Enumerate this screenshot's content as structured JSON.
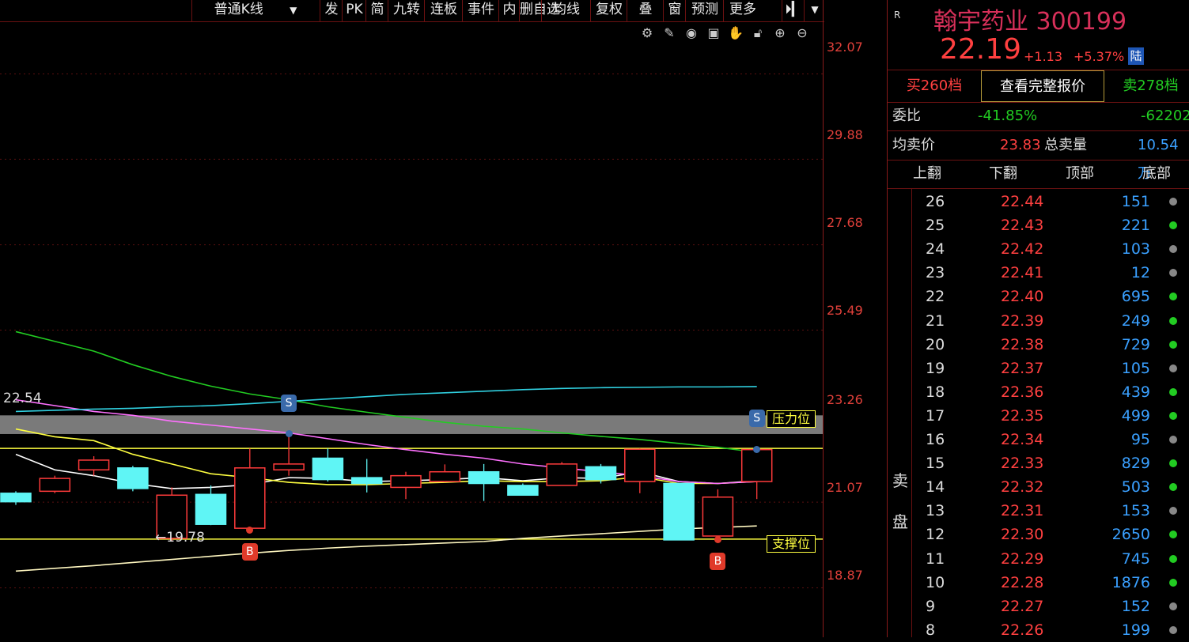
{
  "toolbar": {
    "kline_mode": "普通K线",
    "items": [
      "发",
      "PK",
      "简",
      "九转",
      "连板",
      "事件",
      "内",
      "删自选",
      "均线",
      "复权",
      "叠",
      "窗",
      "预测",
      "更多"
    ]
  },
  "chart_tools": [
    "gear-icon",
    "pen-icon",
    "eye-icon",
    "briefcase-icon",
    "hand-icon",
    "lock-icon",
    "zoom-in-icon",
    "zoom-out-icon"
  ],
  "price_axis": [
    "32.07",
    "29.88",
    "27.68",
    "25.49",
    "23.26",
    "21.07",
    "18.87"
  ],
  "chart_data": {
    "type": "candlestick",
    "ylim": [
      17.6,
      33.4
    ],
    "ma_label": "22.54",
    "low_label": "19.78",
    "resistance_label": "压力位",
    "support_label": "支撑位",
    "resistance_level": 22.45,
    "support_level": 20.12,
    "resistance_band": [
      22.82,
      23.3
    ],
    "candles": [
      {
        "o": 21.3,
        "c": 21.08,
        "h": 21.35,
        "l": 21.0
      },
      {
        "o": 21.35,
        "c": 21.68,
        "h": 21.75,
        "l": 21.3
      },
      {
        "o": 21.9,
        "c": 22.15,
        "h": 22.25,
        "l": 21.75
      },
      {
        "o": 21.95,
        "c": 21.42,
        "h": 22.0,
        "l": 21.35
      },
      {
        "o": 20.14,
        "c": 21.25,
        "h": 21.45,
        "l": 20.08
      },
      {
        "o": 21.27,
        "c": 20.5,
        "h": 21.5,
        "l": 20.48
      },
      {
        "o": 20.4,
        "c": 21.95,
        "h": 22.45,
        "l": 20.35
      },
      {
        "o": 21.9,
        "c": 22.05,
        "h": 22.82,
        "l": 21.75
      },
      {
        "o": 22.2,
        "c": 21.65,
        "h": 22.45,
        "l": 21.6
      },
      {
        "o": 21.7,
        "c": 21.55,
        "h": 22.18,
        "l": 21.32
      },
      {
        "o": 21.45,
        "c": 21.75,
        "h": 21.85,
        "l": 21.15
      },
      {
        "o": 21.6,
        "c": 21.85,
        "h": 22.04,
        "l": 21.58
      },
      {
        "o": 21.85,
        "c": 21.55,
        "h": 22.05,
        "l": 21.1
      },
      {
        "o": 21.5,
        "c": 21.25,
        "h": 21.55,
        "l": 21.25
      },
      {
        "o": 21.5,
        "c": 22.05,
        "h": 22.1,
        "l": 21.5
      },
      {
        "o": 21.98,
        "c": 21.65,
        "h": 22.05,
        "l": 21.55
      },
      {
        "o": 21.6,
        "c": 22.43,
        "h": 22.45,
        "l": 21.3
      },
      {
        "o": 21.55,
        "c": 20.1,
        "h": 21.55,
        "l": 20.1
      },
      {
        "o": 20.2,
        "c": 21.2,
        "h": 21.4,
        "l": 20.1
      },
      {
        "o": 21.6,
        "c": 22.42,
        "h": 22.43,
        "l": 21.15
      }
    ],
    "ma_series": [
      {
        "color": "#ffffff",
        "values": [
          22.3,
          21.9,
          21.75,
          21.55,
          21.42,
          21.45,
          21.52,
          21.7,
          21.68,
          21.6,
          21.62,
          21.65,
          21.7,
          21.62,
          21.7,
          21.68,
          21.85,
          21.6,
          21.55,
          21.62
        ]
      },
      {
        "color": "#ffff40",
        "values": [
          22.95,
          22.75,
          22.65,
          22.3,
          22.05,
          21.8,
          21.7,
          21.58,
          21.52,
          21.52,
          21.55,
          21.58,
          21.62,
          21.6,
          21.6,
          21.62,
          21.72,
          21.55,
          21.55,
          21.6
        ]
      },
      {
        "color": "#ff70ff",
        "values": [
          23.7,
          23.55,
          23.4,
          23.3,
          23.15,
          23.05,
          22.95,
          22.85,
          22.7,
          22.55,
          22.42,
          22.3,
          22.2,
          22.05,
          21.95,
          21.85,
          21.75,
          21.6,
          21.55,
          21.6
        ]
      },
      {
        "color": "#22cc22",
        "values": [
          25.45,
          25.2,
          24.95,
          24.6,
          24.3,
          24.05,
          23.85,
          23.7,
          23.52,
          23.38,
          23.25,
          23.12,
          23.02,
          22.95,
          22.85,
          22.76,
          22.68,
          22.58,
          22.48,
          22.35
        ]
      },
      {
        "color": "#30d0e0",
        "values": [
          23.4,
          23.43,
          23.46,
          23.48,
          23.52,
          23.55,
          23.6,
          23.66,
          23.72,
          23.78,
          23.84,
          23.88,
          23.92,
          23.96,
          23.99,
          24.01,
          24.02,
          24.03,
          24.03,
          24.04
        ]
      },
      {
        "color": "#fff7c0",
        "values": [
          19.3,
          19.37,
          19.44,
          19.52,
          19.6,
          19.68,
          19.76,
          19.83,
          19.89,
          19.94,
          19.98,
          20.02,
          20.06,
          20.14,
          20.2,
          20.26,
          20.32,
          20.38,
          20.42,
          20.46
        ]
      }
    ],
    "signals": [
      {
        "label": "S",
        "index": 7,
        "color": "#3a6aaa"
      },
      {
        "label": "B",
        "index": 6,
        "color": "#e03a2a"
      },
      {
        "label": "B",
        "index": 18,
        "color": "#e03a2a"
      },
      {
        "label": "S",
        "index": 19,
        "color": "#3a6aaa"
      }
    ]
  },
  "quote": {
    "r_tag": "R",
    "name": "翰宇药业 300199",
    "price": "22.19",
    "change": "+1.13",
    "change_pct": "+5.37%",
    "market_tag": "陆"
  },
  "tabs": {
    "buy": "买260档",
    "full": "查看完整报价",
    "sell": "卖278档"
  },
  "ratio": {
    "label": "委比",
    "pct": "-41.85%",
    "value": "-62202"
  },
  "avg": {
    "label": "均卖价",
    "price": "23.83",
    "total_label": "总卖量",
    "total": "10.54万"
  },
  "nav": {
    "up": "上翻",
    "down": "下翻",
    "top": "顶部",
    "bottom": "底部"
  },
  "side_label": [
    "卖",
    "盘"
  ],
  "order_book": [
    {
      "level": "26",
      "price": "22.44",
      "vol": "151",
      "dot": "#888888"
    },
    {
      "level": "25",
      "price": "22.43",
      "vol": "221",
      "dot": "#22cc22"
    },
    {
      "level": "24",
      "price": "22.42",
      "vol": "103",
      "dot": "#888888"
    },
    {
      "level": "23",
      "price": "22.41",
      "vol": "12",
      "dot": "#888888"
    },
    {
      "level": "22",
      "price": "22.40",
      "vol": "695",
      "dot": "#22cc22"
    },
    {
      "level": "21",
      "price": "22.39",
      "vol": "249",
      "dot": "#22cc22"
    },
    {
      "level": "20",
      "price": "22.38",
      "vol": "729",
      "dot": "#22cc22"
    },
    {
      "level": "19",
      "price": "22.37",
      "vol": "105",
      "dot": "#888888"
    },
    {
      "level": "18",
      "price": "22.36",
      "vol": "439",
      "dot": "#22cc22"
    },
    {
      "level": "17",
      "price": "22.35",
      "vol": "499",
      "dot": "#22cc22"
    },
    {
      "level": "16",
      "price": "22.34",
      "vol": "95",
      "dot": "#888888"
    },
    {
      "level": "15",
      "price": "22.33",
      "vol": "829",
      "dot": "#22cc22"
    },
    {
      "level": "14",
      "price": "22.32",
      "vol": "503",
      "dot": "#22cc22"
    },
    {
      "level": "13",
      "price": "22.31",
      "vol": "153",
      "dot": "#888888"
    },
    {
      "level": "12",
      "price": "22.30",
      "vol": "2650",
      "dot": "#22cc22"
    },
    {
      "level": "11",
      "price": "22.29",
      "vol": "745",
      "dot": "#22cc22"
    },
    {
      "level": "10",
      "price": "22.28",
      "vol": "1876",
      "dot": "#22cc22"
    },
    {
      "level": "9",
      "price": "22.27",
      "vol": "152",
      "dot": "#888888"
    },
    {
      "level": "8",
      "price": "22.26",
      "vol": "199",
      "dot": "#888888"
    }
  ]
}
